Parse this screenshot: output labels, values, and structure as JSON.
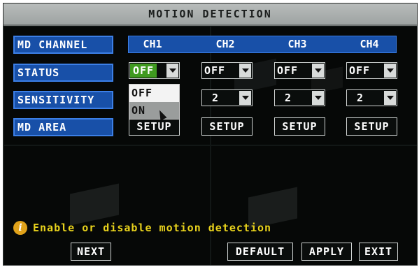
{
  "title": "MOTION DETECTION",
  "labels": {
    "md_channel": "MD CHANNEL",
    "status": "STATUS",
    "sensitivity": "SENSITIVITY",
    "md_area": "MD AREA"
  },
  "channels": [
    "CH1",
    "CH2",
    "CH3",
    "CH4"
  ],
  "status_values": [
    "OFF",
    "OFF",
    "OFF",
    "OFF"
  ],
  "sensitivity_values": [
    "2",
    "2",
    "2"
  ],
  "status_dropdown_options": [
    "OFF",
    "ON"
  ],
  "setup_label": "SETUP",
  "hint": "Enable or disable motion detection",
  "buttons": {
    "next": "NEXT",
    "default": "DEFAULT",
    "apply": "APPLY",
    "exit": "EXIT"
  },
  "colors": {
    "label_bg": "#1850a8",
    "active_select": "#3f9a1f",
    "hint_text": "#e8d21c",
    "info_icon": "#e0a21a"
  },
  "icons": {
    "info": "info-icon",
    "dropdown": "dropdown-arrow-icon",
    "cursor": "mouse-pointer-icon"
  }
}
